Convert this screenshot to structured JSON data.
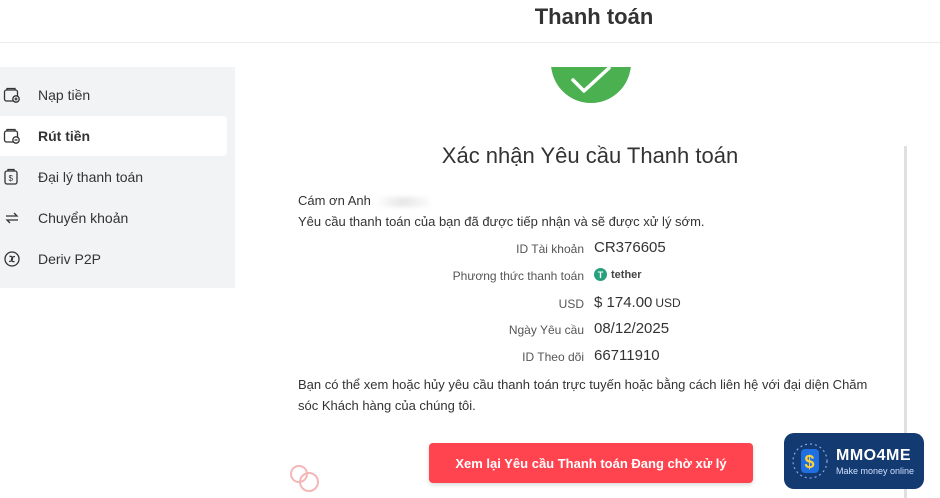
{
  "header": {
    "title": "Thanh toán"
  },
  "sidebar": {
    "items": [
      {
        "label": "Nạp tiền",
        "icon": "wallet-in-icon",
        "active": false
      },
      {
        "label": "Rút tiền",
        "icon": "wallet-out-icon",
        "active": true
      },
      {
        "label": "Đại lý thanh toán",
        "icon": "payment-agent-icon",
        "active": false
      },
      {
        "label": "Chuyển khoản",
        "icon": "transfer-arrows-icon",
        "active": false
      },
      {
        "label": "Deriv P2P",
        "icon": "p2p-icon",
        "active": false
      }
    ]
  },
  "confirmation": {
    "icon": "check-icon",
    "title": "Xác nhận Yêu cầu Thanh toán",
    "greeting": "Cám ơn Anh",
    "notice": "Yêu cầu thanh toán của bạn đã được tiếp nhận và sẽ được xử lý sớm.",
    "details": [
      {
        "label": "ID Tài khoản",
        "value": "CR376605"
      },
      {
        "label": "Phương thức thanh toán",
        "value": "tether"
      },
      {
        "label": "USD",
        "value": "$ 174.00",
        "unit": "USD"
      },
      {
        "label": "Ngày Yêu cầu",
        "value": "08/12/2025"
      },
      {
        "label": "ID Theo dõi",
        "value": "66711910"
      }
    ],
    "paragraph": "Bạn có thể xem hoặc hủy yêu cầu thanh toán trực tuyến hoặc bằng cách liên hệ với đại diện Chăm sóc Khách hàng của chúng tôi.",
    "button_label": "Xem lại Yêu cầu Thanh toán Đang chờ xử lý"
  },
  "watermark": {
    "name": "MMO4ME",
    "tagline": "Make money online"
  },
  "colors": {
    "success": "#4bb04f",
    "primary_button": "#ff444f",
    "sidebar_bg": "#f2f3f4",
    "tether": "#26a17b",
    "watermark_bg": "#143a72"
  }
}
